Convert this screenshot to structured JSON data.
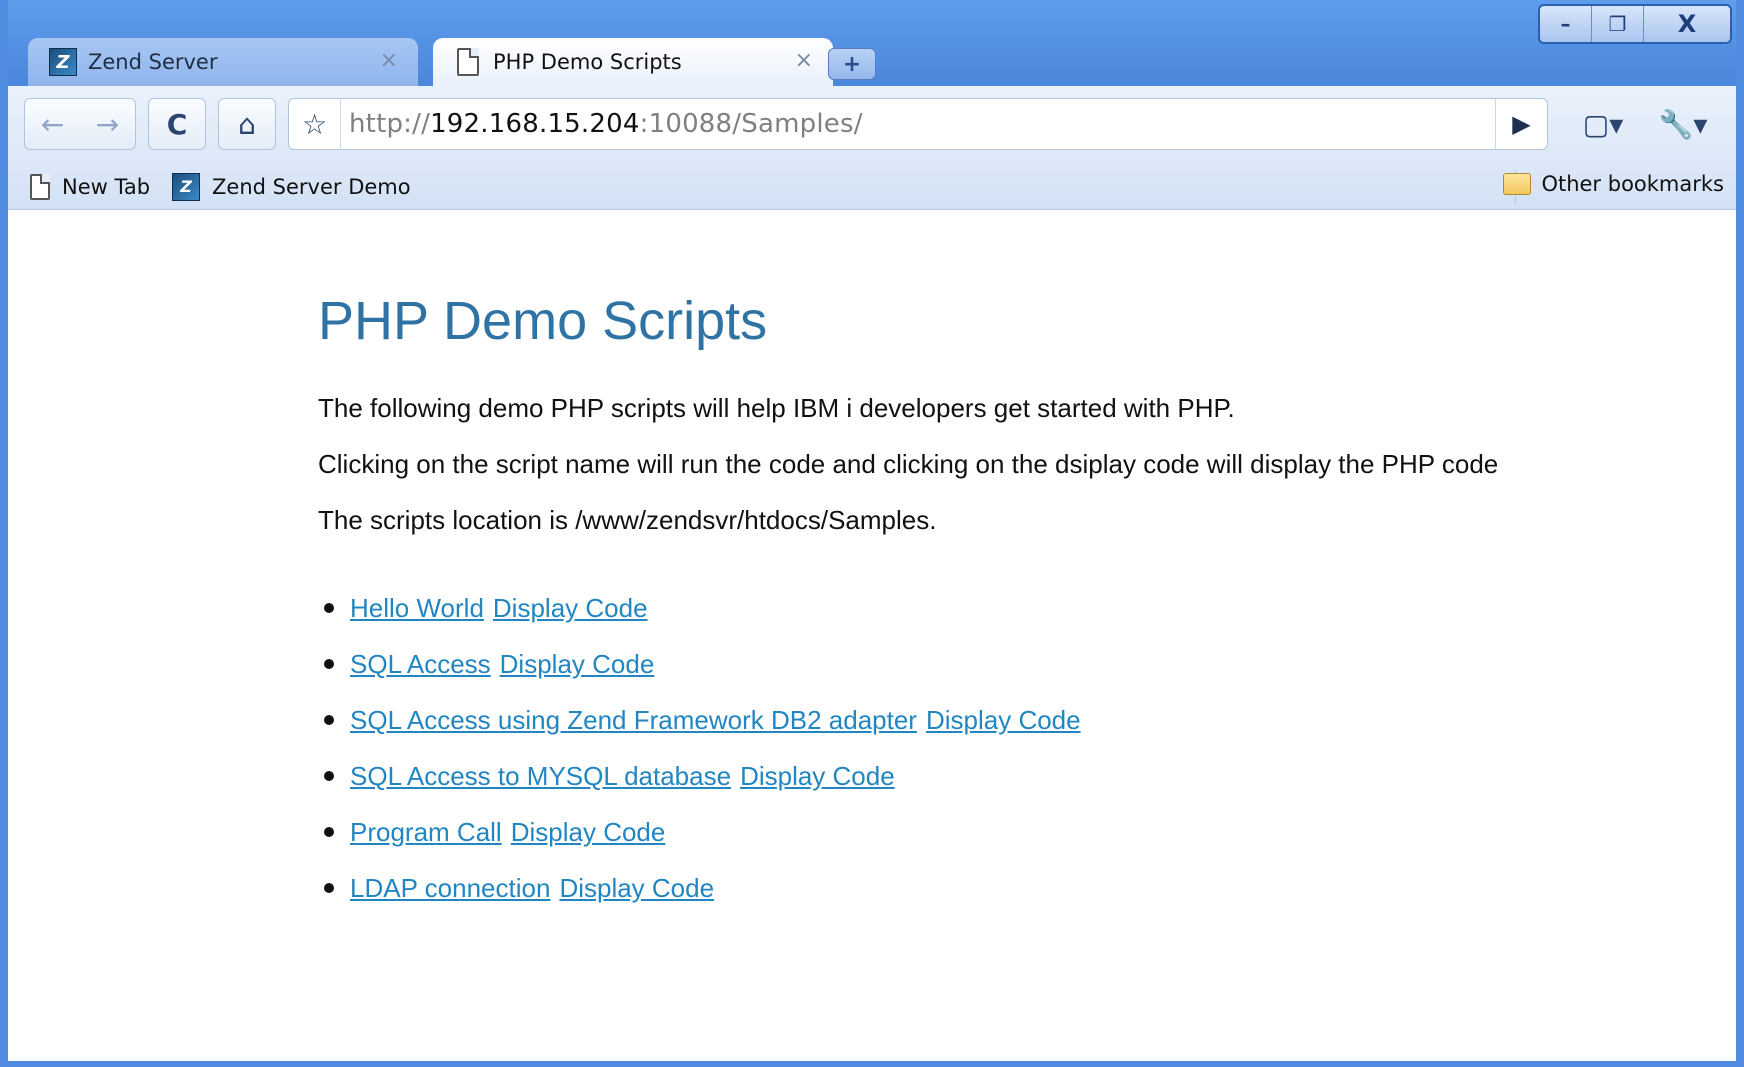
{
  "window": {
    "controls": [
      "–",
      "❐",
      "X"
    ]
  },
  "tabs": [
    {
      "title": "Zend Server",
      "close": "×",
      "icon": "zend-icon"
    },
    {
      "title": "PHP Demo Scripts",
      "close": "×",
      "icon": "page-icon"
    }
  ],
  "newtab": "+",
  "toolbar": {
    "back": "←",
    "forward": "→",
    "reload": "C",
    "home": "⌂",
    "star": "☆",
    "url_scheme": "http://",
    "url_host": "192.168.15.204",
    "url_rest": ":10088/Samples/",
    "go": "▶",
    "page_menu": "▢▾",
    "tools_menu": "🔧▾"
  },
  "bookmarks": {
    "items": [
      {
        "label": "New Tab",
        "icon": "page-icon"
      },
      {
        "label": "Zend Server Demo",
        "icon": "zend-icon"
      }
    ],
    "other": "Other bookmarks"
  },
  "page": {
    "title": "PHP Demo Scripts",
    "paragraphs": [
      "The following demo PHP scripts will help IBM i developers get started with PHP.",
      "Clicking on the script name will run the code and clicking on the dsiplay code will display the PHP code",
      "The scripts location is /www/zendsvr/htdocs/Samples."
    ],
    "links": [
      {
        "name": "Hello World",
        "code": "Display Code"
      },
      {
        "name": "SQL Access",
        "code": "Display Code"
      },
      {
        "name": "SQL Access using Zend Framework DB2 adapter",
        "code": "Display Code"
      },
      {
        "name": "SQL Access to MYSQL database",
        "code": "Display Code"
      },
      {
        "name": "Program Call",
        "code": "Display Code"
      },
      {
        "name": "LDAP connection",
        "code": "Display Code"
      }
    ]
  },
  "colors": {
    "title": "#2f73a4",
    "link": "#2186c1",
    "frame": "#4f8be0"
  }
}
